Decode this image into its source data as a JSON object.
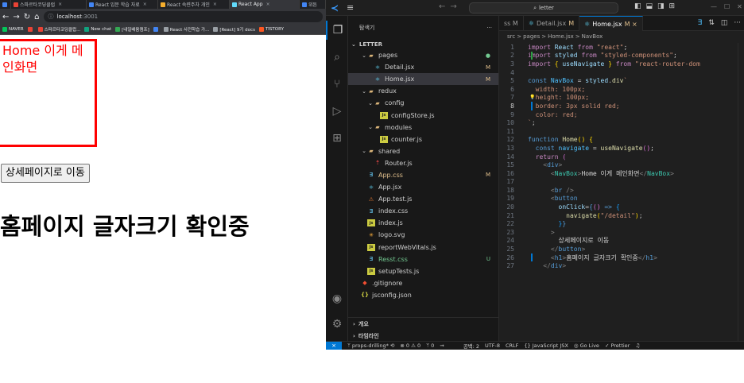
{
  "browser": {
    "tabs": [
      {
        "label": "",
        "color": "#4285f4",
        "active": false
      },
      {
        "label": "스파르타코딩클럽",
        "color": "#ea4335",
        "active": false
      },
      {
        "label": "React 입문 학습 자료",
        "color": "#4285f4",
        "active": false
      },
      {
        "label": "React 숙련주차 개인",
        "color": "#f6ae2d",
        "active": false
      },
      {
        "label": "React App",
        "color": "#61dafb",
        "active": true
      },
      {
        "label": "위튼",
        "color": "#4285f4",
        "active": false
      }
    ],
    "address": {
      "host": "localhost",
      "port": ":3001"
    },
    "bookmarks": [
      {
        "label": "NAVER",
        "color": "#03c75a"
      },
      {
        "label": "",
        "color": "#ea4335"
      },
      {
        "label": "스파르타코딩클럽...",
        "color": "#ea4335"
      },
      {
        "label": "New chat",
        "color": "#10a37f"
      },
      {
        "label": "[내일배움캠프]",
        "color": "#34a853"
      },
      {
        "label": "",
        "color": "#4285f4"
      },
      {
        "label": "React 사전학습 가...",
        "color": "#9aa0a6"
      },
      {
        "label": "[React] 9기 docs",
        "color": "#9aa0a6"
      },
      {
        "label": "TISTORY",
        "color": "#ff5722"
      }
    ],
    "page": {
      "navbox_text": "Home 이게 메인화면",
      "detail_button": "상세페이지로 이동",
      "heading": "홈페이지 글자크기 확인중"
    }
  },
  "vscode": {
    "command_center": "letter",
    "sidebar": {
      "title": "탐색기",
      "more": "···",
      "project": "LETTER",
      "items": [
        {
          "label": "pages",
          "indent": 1,
          "chev": "⌄",
          "icon": "folder",
          "status": "●",
          "status_color": "#73c991"
        },
        {
          "label": "Detail.jsx",
          "indent": 2,
          "chev": "",
          "icon": "react",
          "status": "M",
          "status_color": "#e2c08d"
        },
        {
          "label": "Home.jsx",
          "indent": 2,
          "chev": "",
          "icon": "react",
          "status": "M",
          "status_color": "#e2c08d",
          "selected": true
        },
        {
          "label": "redux",
          "indent": 1,
          "chev": "⌄",
          "icon": "folder",
          "status": "",
          "status_color": ""
        },
        {
          "label": "config",
          "indent": 2,
          "chev": "⌄",
          "icon": "folder",
          "status": "",
          "status_color": ""
        },
        {
          "label": "configStore.js",
          "indent": 3,
          "chev": "",
          "icon": "js",
          "status": "",
          "status_color": ""
        },
        {
          "label": "modules",
          "indent": 2,
          "chev": "⌄",
          "icon": "folder",
          "status": "",
          "status_color": ""
        },
        {
          "label": "counter.js",
          "indent": 3,
          "chev": "",
          "icon": "js",
          "status": "",
          "status_color": ""
        },
        {
          "label": "shared",
          "indent": 1,
          "chev": "⌄",
          "icon": "folder",
          "status": "",
          "status_color": ""
        },
        {
          "label": "Router.js",
          "indent": 2,
          "chev": "",
          "icon": "router",
          "status": "",
          "status_color": ""
        },
        {
          "label": "App.css",
          "indent": 1,
          "chev": "",
          "icon": "css",
          "status": "M",
          "status_color": "#e2c08d",
          "color": "#e2c08d"
        },
        {
          "label": "App.jsx",
          "indent": 1,
          "chev": "",
          "icon": "react",
          "status": "",
          "status_color": ""
        },
        {
          "label": "App.test.js",
          "indent": 1,
          "chev": "",
          "icon": "test",
          "status": "",
          "status_color": ""
        },
        {
          "label": "index.css",
          "indent": 1,
          "chev": "",
          "icon": "css",
          "status": "",
          "status_color": ""
        },
        {
          "label": "index.js",
          "indent": 1,
          "chev": "",
          "icon": "js",
          "status": "",
          "status_color": ""
        },
        {
          "label": "logo.svg",
          "indent": 1,
          "chev": "",
          "icon": "svg",
          "status": "",
          "status_color": ""
        },
        {
          "label": "reportWebVitals.js",
          "indent": 1,
          "chev": "",
          "icon": "js",
          "status": "",
          "status_color": ""
        },
        {
          "label": "Resst.css",
          "indent": 1,
          "chev": "",
          "icon": "css",
          "status": "U",
          "status_color": "#73c991",
          "color": "#73c991"
        },
        {
          "label": "setupTests.js",
          "indent": 1,
          "chev": "",
          "icon": "js",
          "status": "",
          "status_color": ""
        },
        {
          "label": ".gitignore",
          "indent": 0,
          "chev": "",
          "icon": "git",
          "status": "",
          "status_color": ""
        },
        {
          "label": "jsconfig.json",
          "indent": 0,
          "chev": "",
          "icon": "json",
          "status": "",
          "status_color": ""
        }
      ],
      "footer": [
        "개요",
        "타임라인"
      ]
    },
    "tabs": [
      {
        "label": "ss M",
        "active": false,
        "icon": "",
        "modified": ""
      },
      {
        "label": "Detail.jsx",
        "active": false,
        "icon": "react",
        "modified": "M"
      },
      {
        "label": "Home.jsx",
        "active": true,
        "icon": "react",
        "modified": "M ×"
      }
    ],
    "breadcrumbs": [
      "src",
      ">",
      "pages",
      ">",
      "Home.jsx",
      ">",
      "NavBox"
    ],
    "current_line": 8,
    "code_lines": [
      {
        "n": 1,
        "g": "",
        "tokens": [
          [
            "k",
            "import "
          ],
          [
            "v",
            "React "
          ],
          [
            "k",
            "from "
          ],
          [
            "s",
            "\"react\""
          ],
          [
            "p",
            ";"
          ]
        ]
      },
      {
        "n": 2,
        "g": "add",
        "tokens": [
          [
            "k",
            "import "
          ],
          [
            "v",
            "styled "
          ],
          [
            "k",
            "from "
          ],
          [
            "s",
            "\"styled-components\""
          ],
          [
            "p",
            ";"
          ]
        ]
      },
      {
        "n": 3,
        "g": "",
        "tokens": [
          [
            "k",
            "import "
          ],
          [
            "y",
            "{ "
          ],
          [
            "v",
            "useNavigate "
          ],
          [
            "y",
            "} "
          ],
          [
            "k",
            "from "
          ],
          [
            "s",
            "\"react-router-dom"
          ]
        ]
      },
      {
        "n": 4,
        "g": "",
        "tokens": []
      },
      {
        "n": 5,
        "g": "",
        "tokens": [
          [
            "kb",
            "const "
          ],
          [
            "c",
            "NavBox "
          ],
          [
            "p",
            "= "
          ],
          [
            "v",
            "styled"
          ],
          [
            "p",
            "."
          ],
          [
            "f",
            "div"
          ],
          [
            "sc",
            "`"
          ]
        ]
      },
      {
        "n": 6,
        "g": "",
        "tokens": [
          [
            "sc",
            "  width: 100px;"
          ]
        ]
      },
      {
        "n": 7,
        "g": "",
        "tokens": [
          [
            "sc",
            "  height: 100px;"
          ]
        ]
      },
      {
        "n": 8,
        "g": "mod",
        "tokens": [
          [
            "sc",
            "  border: 3px solid red;"
          ]
        ]
      },
      {
        "n": 9,
        "g": "",
        "tokens": [
          [
            "sc",
            "  color: red;"
          ]
        ]
      },
      {
        "n": 10,
        "g": "",
        "tokens": [
          [
            "sc",
            "`"
          ],
          [
            "p",
            ";"
          ]
        ]
      },
      {
        "n": 11,
        "g": "",
        "tokens": []
      },
      {
        "n": 12,
        "g": "",
        "tokens": [
          [
            "kb",
            "function "
          ],
          [
            "f",
            "Home"
          ],
          [
            "y",
            "() {"
          ]
        ]
      },
      {
        "n": 13,
        "g": "",
        "tokens": [
          [
            "kb",
            "  const "
          ],
          [
            "c",
            "navigate "
          ],
          [
            "p",
            "= "
          ],
          [
            "f",
            "useNavigate"
          ],
          [
            "pk",
            "()"
          ],
          [
            "p",
            ";"
          ]
        ]
      },
      {
        "n": 14,
        "g": "",
        "tokens": [
          [
            "k",
            "  return "
          ],
          [
            "pk",
            "("
          ]
        ]
      },
      {
        "n": 15,
        "g": "",
        "tokens": [
          [
            "tag",
            "    <"
          ],
          [
            "kb",
            "div"
          ],
          [
            "tag",
            ">"
          ]
        ]
      },
      {
        "n": 16,
        "g": "",
        "tokens": [
          [
            "tag",
            "      <"
          ],
          [
            "jt",
            "NavBox"
          ],
          [
            "tag",
            ">"
          ],
          [
            "pr",
            "Home 이게 메인화면"
          ],
          [
            "tag",
            "</"
          ],
          [
            "jt",
            "NavBox"
          ],
          [
            "tag",
            ">"
          ]
        ]
      },
      {
        "n": 17,
        "g": "",
        "tokens": []
      },
      {
        "n": 18,
        "g": "",
        "tokens": [
          [
            "tag",
            "      <"
          ],
          [
            "kb",
            "br "
          ],
          [
            "tag",
            "/>"
          ]
        ]
      },
      {
        "n": 19,
        "g": "",
        "tokens": [
          [
            "tag",
            "      <"
          ],
          [
            "kb",
            "button"
          ]
        ]
      },
      {
        "n": 20,
        "g": "",
        "tokens": [
          [
            "v",
            "        onClick"
          ],
          [
            "p",
            "="
          ],
          [
            "kb",
            "{"
          ],
          [
            "pk",
            "() "
          ],
          [
            "kb",
            "=> "
          ],
          [
            "bl",
            "{"
          ]
        ]
      },
      {
        "n": 21,
        "g": "",
        "tokens": [
          [
            "f",
            "          navigate"
          ],
          [
            "y",
            "("
          ],
          [
            "s",
            "\"/detail\""
          ],
          [
            "y",
            ")"
          ],
          [
            "p",
            ";"
          ]
        ]
      },
      {
        "n": 22,
        "g": "",
        "tokens": [
          [
            "bl",
            "        }"
          ],
          [
            "kb",
            "}"
          ]
        ]
      },
      {
        "n": 23,
        "g": "",
        "tokens": [
          [
            "tag",
            "      >"
          ]
        ]
      },
      {
        "n": 24,
        "g": "",
        "tokens": [
          [
            "pr",
            "        상세페이지로 이동"
          ]
        ]
      },
      {
        "n": 25,
        "g": "",
        "tokens": [
          [
            "tag",
            "      </"
          ],
          [
            "kb",
            "button"
          ],
          [
            "tag",
            ">"
          ]
        ]
      },
      {
        "n": 26,
        "g": "mod",
        "tokens": [
          [
            "tag",
            "      <"
          ],
          [
            "kb",
            "h1"
          ],
          [
            "tag",
            ">"
          ],
          [
            "pr",
            "홈페이지 글자크기 확인중"
          ],
          [
            "tag",
            "</"
          ],
          [
            "kb",
            "h1"
          ],
          [
            "tag",
            ">"
          ]
        ]
      },
      {
        "n": 27,
        "g": "",
        "tokens": [
          [
            "tag",
            "    </"
          ],
          [
            "kb",
            "div"
          ],
          [
            "tag",
            ">"
          ]
        ]
      }
    ],
    "status": {
      "branch": "props-drilling*",
      "errors": "⊗ 0 ⚠ 0",
      "ports": "ᛘ 0",
      "spaces": "공백: 2",
      "encoding": "UTF-8",
      "eol": "CRLF",
      "language": "{} JavaScript JSX",
      "golive": "Go Live",
      "prettier": "✓ Prettier"
    }
  }
}
